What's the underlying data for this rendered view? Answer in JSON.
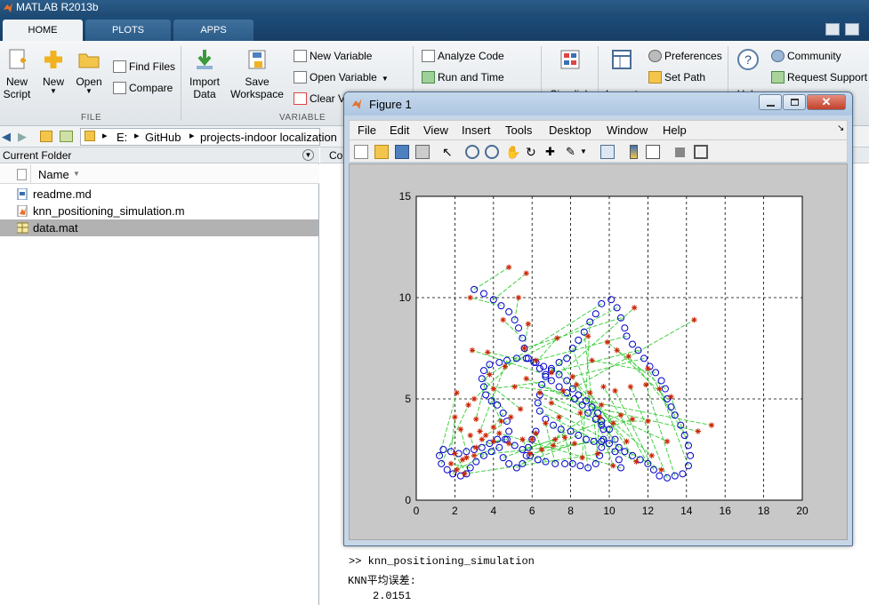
{
  "window": {
    "title": "MATLAB R2013b"
  },
  "tabs": [
    {
      "label": "HOME",
      "active": true
    },
    {
      "label": "PLOTS",
      "active": false
    },
    {
      "label": "APPS",
      "active": false
    }
  ],
  "ribbon": {
    "new_script": "New\nScript",
    "new": "New",
    "open": "Open",
    "find_files": "Find Files",
    "compare": "Compare",
    "file_group": "FILE",
    "import_data": "Import\nData",
    "save_workspace": "Save\nWorkspace",
    "new_variable": "New Variable",
    "open_variable": "Open Variable",
    "clear_workspace": "Clear V",
    "variable_group": "VARIABLE",
    "analyze_code": "Analyze Code",
    "run_and_time": "Run and Time",
    "simulink": "Simulink",
    "layout": "Layout",
    "preferences": "Preferences",
    "set_path": "Set Path",
    "help": "Help",
    "community": "Community",
    "request_support": "Request Support"
  },
  "address": {
    "drive": "E:",
    "folder1": "GitHub",
    "folder2": "projects-indoor localization"
  },
  "current_folder": {
    "title": "Current Folder",
    "column_name": "Name",
    "files": [
      {
        "name": "readme.md",
        "type": "md",
        "selected": false
      },
      {
        "name": "knn_positioning_simulation.m",
        "type": "m",
        "selected": false
      },
      {
        "name": "data.mat",
        "type": "mat",
        "selected": true
      }
    ]
  },
  "command_window": {
    "header_fragment": "Co",
    "prompt": ">>",
    "command": "knn_positioning_simulation",
    "output_label": "KNN平均误差:",
    "output_value": "2.0151"
  },
  "figure": {
    "title": "Figure 1",
    "menus": [
      "File",
      "Edit",
      "View",
      "Insert",
      "Tools",
      "Desktop",
      "Window",
      "Help"
    ]
  },
  "chart_data": {
    "type": "scatter",
    "xlim": [
      0,
      20
    ],
    "ylim": [
      0,
      15
    ],
    "xticks": [
      "0",
      "2",
      "4",
      "6",
      "8",
      "10",
      "12",
      "14",
      "16",
      "18",
      "20"
    ],
    "yticks": [
      "0",
      "5",
      "10",
      "15"
    ],
    "grid": true,
    "colors": {
      "true_path": "#0000cc",
      "estimated": "#cc2200",
      "error_lines": "#33cc33"
    },
    "true_path": [
      [
        3.0,
        10.4
      ],
      [
        3.5,
        10.2
      ],
      [
        4.0,
        9.9
      ],
      [
        4.4,
        9.6
      ],
      [
        4.8,
        9.3
      ],
      [
        5.1,
        8.9
      ],
      [
        5.3,
        8.5
      ],
      [
        5.5,
        8.0
      ],
      [
        5.6,
        7.5
      ],
      [
        5.8,
        7.0
      ],
      [
        6.2,
        6.8
      ],
      [
        6.6,
        6.6
      ],
      [
        7.0,
        6.4
      ],
      [
        7.4,
        6.2
      ],
      [
        7.8,
        5.9
      ],
      [
        8.1,
        5.5
      ],
      [
        8.4,
        5.2
      ],
      [
        8.8,
        4.9
      ],
      [
        9.1,
        4.6
      ],
      [
        9.4,
        4.3
      ],
      [
        9.6,
        3.9
      ],
      [
        9.7,
        3.5
      ],
      [
        9.7,
        3.0
      ],
      [
        9.6,
        2.6
      ],
      [
        9.5,
        2.2
      ],
      [
        9.3,
        1.8
      ],
      [
        8.9,
        1.6
      ],
      [
        8.5,
        1.7
      ],
      [
        8.1,
        1.8
      ],
      [
        7.7,
        1.8
      ],
      [
        7.2,
        1.8
      ],
      [
        6.7,
        1.9
      ],
      [
        6.3,
        2.0
      ],
      [
        5.9,
        2.2
      ],
      [
        5.5,
        2.5
      ],
      [
        5.1,
        2.7
      ],
      [
        4.7,
        3.0
      ],
      [
        4.2,
        3.0
      ],
      [
        3.8,
        2.8
      ],
      [
        3.4,
        2.6
      ],
      [
        3.0,
        2.5
      ],
      [
        2.6,
        2.4
      ],
      [
        2.2,
        2.3
      ],
      [
        1.8,
        2.4
      ],
      [
        1.4,
        2.5
      ],
      [
        1.2,
        2.2
      ],
      [
        1.3,
        1.8
      ],
      [
        1.6,
        1.5
      ],
      [
        1.9,
        1.3
      ],
      [
        2.3,
        1.2
      ],
      [
        2.6,
        1.3
      ],
      [
        2.8,
        1.6
      ],
      [
        3.1,
        1.9
      ],
      [
        3.5,
        2.2
      ],
      [
        3.9,
        2.4
      ],
      [
        4.3,
        2.6
      ],
      [
        4.6,
        3.0
      ],
      [
        4.8,
        3.4
      ],
      [
        4.7,
        3.9
      ],
      [
        4.5,
        4.3
      ],
      [
        4.2,
        4.7
      ],
      [
        3.9,
        4.9
      ],
      [
        3.6,
        5.2
      ],
      [
        3.5,
        5.6
      ],
      [
        3.4,
        6.0
      ],
      [
        3.5,
        6.4
      ],
      [
        3.8,
        6.7
      ],
      [
        4.3,
        6.8
      ],
      [
        4.7,
        6.9
      ],
      [
        5.2,
        7.0
      ],
      [
        5.7,
        7.0
      ],
      [
        6.1,
        6.8
      ],
      [
        6.4,
        6.5
      ],
      [
        6.7,
        6.2
      ],
      [
        7.0,
        5.9
      ],
      [
        7.4,
        5.6
      ],
      [
        7.8,
        5.3
      ],
      [
        8.2,
        5.0
      ],
      [
        8.6,
        4.7
      ],
      [
        8.9,
        4.3
      ],
      [
        9.3,
        4.0
      ],
      [
        9.6,
        3.7
      ],
      [
        10.0,
        3.5
      ],
      [
        10.3,
        3.0
      ],
      [
        10.5,
        2.6
      ],
      [
        10.8,
        2.4
      ],
      [
        11.2,
        2.2
      ],
      [
        11.6,
        2.0
      ],
      [
        12.0,
        1.8
      ],
      [
        12.3,
        1.5
      ],
      [
        12.6,
        1.2
      ],
      [
        13.0,
        1.1
      ],
      [
        13.4,
        1.2
      ],
      [
        13.8,
        1.3
      ],
      [
        14.1,
        1.7
      ],
      [
        14.2,
        2.2
      ],
      [
        14.1,
        2.7
      ],
      [
        13.9,
        3.2
      ],
      [
        13.7,
        3.7
      ],
      [
        13.4,
        4.2
      ],
      [
        13.2,
        4.6
      ],
      [
        13.0,
        5.0
      ],
      [
        12.9,
        5.5
      ],
      [
        12.7,
        5.9
      ],
      [
        12.4,
        6.3
      ],
      [
        12.1,
        6.6
      ],
      [
        11.8,
        7.0
      ],
      [
        11.5,
        7.4
      ],
      [
        11.2,
        7.7
      ],
      [
        10.9,
        8.1
      ],
      [
        10.8,
        8.5
      ],
      [
        10.6,
        9.0
      ],
      [
        10.4,
        9.5
      ],
      [
        10.1,
        9.9
      ],
      [
        9.6,
        9.7
      ],
      [
        9.3,
        9.2
      ],
      [
        9.0,
        8.8
      ],
      [
        8.7,
        8.3
      ],
      [
        8.4,
        7.9
      ],
      [
        8.1,
        7.5
      ],
      [
        7.8,
        7.0
      ],
      [
        7.4,
        6.8
      ],
      [
        7.0,
        6.5
      ],
      [
        6.7,
        6.1
      ],
      [
        6.5,
        5.7
      ],
      [
        6.4,
        5.2
      ],
      [
        6.3,
        4.8
      ],
      [
        6.4,
        4.4
      ],
      [
        6.7,
        4.0
      ],
      [
        7.1,
        3.7
      ],
      [
        7.5,
        3.5
      ],
      [
        8.0,
        3.4
      ],
      [
        8.4,
        3.2
      ],
      [
        8.8,
        3.0
      ],
      [
        9.2,
        2.9
      ],
      [
        9.6,
        2.9
      ],
      [
        10.0,
        2.8
      ],
      [
        10.3,
        2.4
      ],
      [
        10.5,
        2.0
      ],
      [
        10.6,
        1.6
      ],
      [
        6.2,
        3.4
      ],
      [
        6.0,
        3.0
      ],
      [
        5.8,
        2.6
      ],
      [
        5.7,
        2.2
      ],
      [
        5.5,
        1.8
      ],
      [
        5.2,
        1.6
      ],
      [
        4.8,
        1.8
      ],
      [
        4.5,
        2.1
      ]
    ],
    "estimated": [
      [
        4.8,
        11.5
      ],
      [
        5.7,
        11.2
      ],
      [
        2.8,
        10.0
      ],
      [
        5.3,
        10.0
      ],
      [
        4.5,
        8.9
      ],
      [
        5.8,
        8.7
      ],
      [
        7.3,
        8.0
      ],
      [
        8.9,
        8.1
      ],
      [
        11.3,
        9.5
      ],
      [
        14.4,
        8.9
      ],
      [
        15.3,
        3.7
      ],
      [
        14.6,
        3.4
      ],
      [
        12.0,
        3.9
      ],
      [
        11.2,
        4.0
      ],
      [
        10.2,
        3.8
      ],
      [
        9.5,
        4.1
      ],
      [
        8.5,
        4.3
      ],
      [
        7.4,
        4.1
      ],
      [
        6.7,
        3.8
      ],
      [
        6.2,
        3.3
      ],
      [
        5.5,
        3.0
      ],
      [
        4.8,
        2.8
      ],
      [
        4.0,
        2.9
      ],
      [
        3.4,
        3.0
      ],
      [
        2.8,
        3.2
      ],
      [
        2.3,
        3.5
      ],
      [
        2.0,
        4.1
      ],
      [
        2.1,
        5.3
      ],
      [
        2.7,
        4.7
      ],
      [
        2.4,
        2.0
      ],
      [
        2.0,
        2.3
      ],
      [
        1.8,
        1.8
      ],
      [
        2.1,
        1.5
      ],
      [
        2.6,
        2.1
      ],
      [
        3.1,
        2.6
      ],
      [
        3.6,
        3.2
      ],
      [
        4.0,
        3.6
      ],
      [
        4.4,
        3.9
      ],
      [
        4.9,
        4.1
      ],
      [
        5.4,
        4.5
      ],
      [
        3.1,
        4.0
      ],
      [
        3.3,
        3.4
      ],
      [
        3.0,
        5.0
      ],
      [
        3.7,
        7.3
      ],
      [
        2.9,
        7.4
      ],
      [
        4.0,
        5.5
      ],
      [
        5.1,
        5.6
      ],
      [
        5.7,
        6.0
      ],
      [
        6.4,
        5.3
      ],
      [
        7.0,
        4.8
      ],
      [
        7.6,
        5.4
      ],
      [
        8.3,
        5.7
      ],
      [
        9.0,
        5.3
      ],
      [
        9.7,
        5.6
      ],
      [
        10.3,
        5.4
      ],
      [
        11.1,
        5.6
      ],
      [
        11.9,
        5.7
      ],
      [
        12.6,
        5.5
      ],
      [
        13.2,
        5.1
      ],
      [
        12.0,
        6.5
      ],
      [
        11.0,
        7.1
      ],
      [
        10.4,
        7.4
      ],
      [
        9.9,
        7.8
      ],
      [
        9.1,
        6.9
      ],
      [
        8.1,
        6.1
      ],
      [
        7.0,
        6.3
      ],
      [
        6.2,
        6.9
      ],
      [
        5.6,
        7.5
      ],
      [
        4.6,
        6.6
      ],
      [
        3.8,
        6.2
      ],
      [
        8.6,
        2.1
      ],
      [
        9.4,
        2.3
      ],
      [
        10.2,
        1.7
      ],
      [
        10.9,
        2.9
      ],
      [
        12.2,
        2.2
      ],
      [
        13.0,
        2.9
      ],
      [
        12.7,
        1.5
      ],
      [
        11.4,
        1.9
      ],
      [
        7.7,
        3.1
      ],
      [
        7.1,
        2.7
      ],
      [
        6.5,
        2.5
      ],
      [
        5.9,
        2.3
      ],
      [
        3.0,
        2.2
      ],
      [
        2.5,
        1.3
      ],
      [
        4.3,
        3.3
      ],
      [
        6.0,
        3.0
      ],
      [
        7.2,
        3.0
      ],
      [
        8.2,
        2.8
      ],
      [
        9.6,
        4.7
      ],
      [
        10.6,
        4.2
      ]
    ]
  }
}
